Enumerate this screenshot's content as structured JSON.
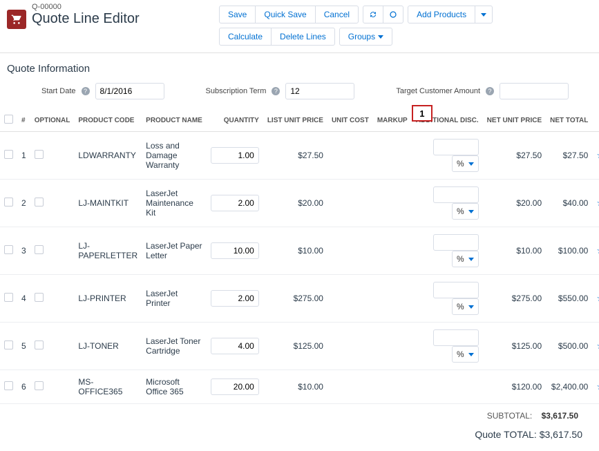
{
  "header": {
    "quote_number": "Q-00000",
    "title": "Quote Line Editor"
  },
  "toolbar": {
    "save": "Save",
    "quick_save": "Quick Save",
    "cancel": "Cancel",
    "add_products": "Add Products",
    "calculate": "Calculate",
    "delete_lines": "Delete Lines",
    "groups": "Groups"
  },
  "section": {
    "quote_info": "Quote Information",
    "start_date_label": "Start Date",
    "start_date_value": "8/1/2016",
    "sub_term_label": "Subscription Term",
    "sub_term_value": "12",
    "target_amt_label": "Target Customer Amount",
    "target_amt_value": ""
  },
  "columns": {
    "num": "#",
    "optional": "OPTIONAL",
    "product_code": "PRODUCT CODE",
    "product_name": "PRODUCT NAME",
    "quantity": "QUANTITY",
    "list_unit_price": "LIST UNIT PRICE",
    "unit_cost": "UNIT COST",
    "markup": "MARKUP",
    "additional_disc": "ADDITIONAL DISC.",
    "net_unit_price": "NET UNIT PRICE",
    "net_total": "NET TOTAL"
  },
  "callout": "1",
  "rows": [
    {
      "n": "1",
      "code": "LDWARRANTY",
      "name": "Loss and Damage Warranty",
      "qty": "1.00",
      "list": "$27.50",
      "disc_unit": "%",
      "nup": "$27.50",
      "nt": "$27.50"
    },
    {
      "n": "2",
      "code": "LJ-MAINTKIT",
      "name": "LaserJet Maintenance Kit",
      "qty": "2.00",
      "list": "$20.00",
      "disc_unit": "%",
      "nup": "$20.00",
      "nt": "$40.00"
    },
    {
      "n": "3",
      "code": "LJ-PAPERLETTER",
      "name": "LaserJet Paper Letter",
      "qty": "10.00",
      "list": "$10.00",
      "disc_unit": "%",
      "nup": "$10.00",
      "nt": "$100.00"
    },
    {
      "n": "4",
      "code": "LJ-PRINTER",
      "name": "LaserJet Printer",
      "qty": "2.00",
      "list": "$275.00",
      "disc_unit": "%",
      "nup": "$275.00",
      "nt": "$550.00"
    },
    {
      "n": "5",
      "code": "LJ-TONER",
      "name": "LaserJet Toner Cartridge",
      "qty": "4.00",
      "list": "$125.00",
      "disc_unit": "%",
      "nup": "$125.00",
      "nt": "$500.00"
    },
    {
      "n": "6",
      "code": "MS-OFFICE365",
      "name": "Microsoft Office 365",
      "qty": "20.00",
      "list": "$10.00",
      "disc_unit": "",
      "nup": "$120.00",
      "nt": "$2,400.00"
    }
  ],
  "totals": {
    "subtotal_label": "SUBTOTAL:",
    "subtotal_value": "$3,617.50",
    "quote_total_label": "Quote TOTAL:",
    "quote_total_value": "$3,617.50"
  }
}
